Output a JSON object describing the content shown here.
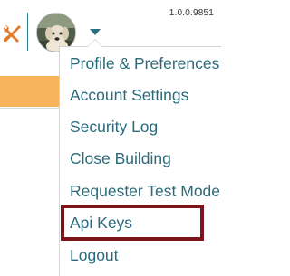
{
  "app": {
    "version": "1.0.0.9851"
  },
  "toolbar": {
    "tools_icon": "wrench-screwdriver-icon",
    "avatar_icon": "user-avatar-photo",
    "menu_toggle_icon": "chevron-down-icon"
  },
  "user_menu": {
    "items": [
      {
        "label": "Profile & Preferences"
      },
      {
        "label": "Account Settings"
      },
      {
        "label": "Security Log"
      },
      {
        "label": "Close Building"
      },
      {
        "label": "Requester Test Mode"
      },
      {
        "label": "Api Keys",
        "highlighted": true
      },
      {
        "label": "Logout"
      }
    ]
  },
  "colors": {
    "menu_text": "#2b6b7b",
    "highlight_border": "#7a1418",
    "header_bar": "#f7b45a",
    "toolbar_accent": "#2a7f8a",
    "tools_icon_color": "#e07a2c"
  }
}
